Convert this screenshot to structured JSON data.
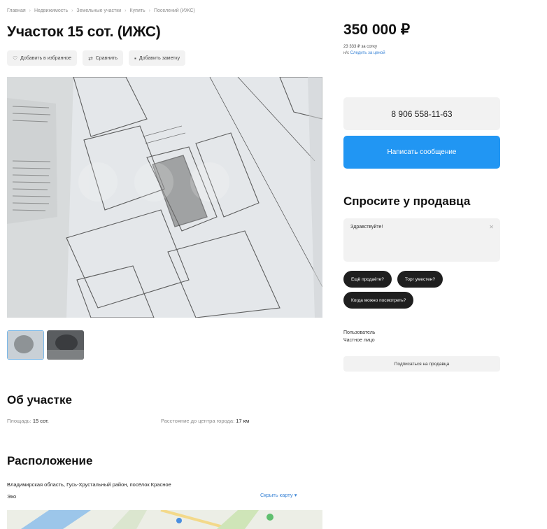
{
  "breadcrumb": [
    "Главная",
    "Недвижимость",
    "Земельные участки",
    "Купить",
    "Поселений (ИЖС)"
  ],
  "title": "Участок 15 сот. (ИЖС)",
  "actions": {
    "favorite": "Добавить в избранное",
    "compare": "Сравнить",
    "note": "Добавить заметку"
  },
  "icons": {
    "favorite": "heart-icon",
    "compare": "compare-icon",
    "note": "note-icon"
  },
  "about": {
    "heading": "Об участке",
    "area_label": "Площадь:",
    "area_value": "15 сот.",
    "distance_label": "Расстояние до центра города:",
    "distance_value": "17 км"
  },
  "location": {
    "heading": "Расположение",
    "address_line1": "Владимирская область, Гусь-Хрустальный район, посёлок Красное",
    "address_line2": "Эхо",
    "map_link": "Скрыть карту"
  },
  "price": {
    "amount": "350 000 ₽",
    "per_unit": "23 333 ₽ за сотку",
    "history_prefix": "н/с",
    "history_link": "Следить за ценой"
  },
  "contact": {
    "phone": "8 906 558-11-63",
    "message_button": "Написать сообщение"
  },
  "ask": {
    "heading": "Спросите у продавца",
    "message": "Здравствуйте!",
    "chips": [
      "Ещё продаёте?",
      "Торг уместен?",
      "Когда можно посмотреть?"
    ]
  },
  "seller": {
    "name": "Пользователь",
    "type": "Частное лицо",
    "subscribe": "Подписаться на продавца"
  },
  "colors": {
    "accent_blue": "#2196f3",
    "link_blue": "#3a84d6",
    "chip_dark": "#1f1f1f",
    "button_gray": "#f2f2f2"
  }
}
